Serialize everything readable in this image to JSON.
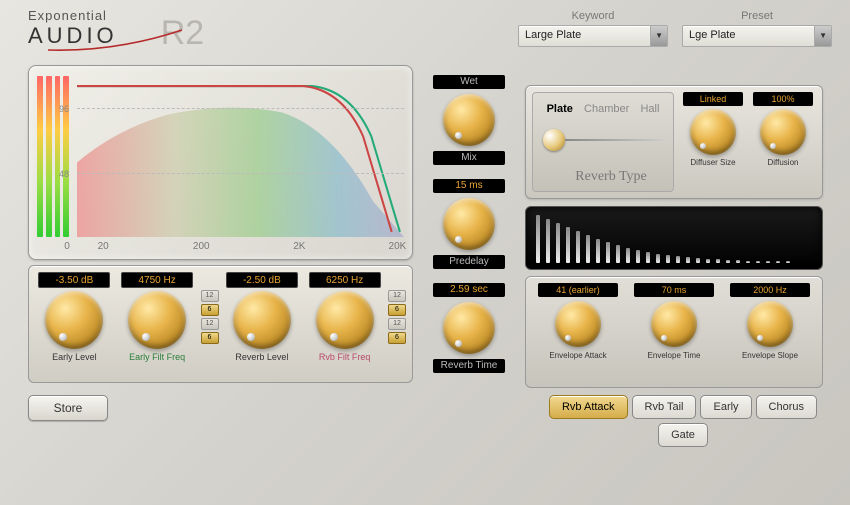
{
  "brand": {
    "line1": "Exponential",
    "line2": "AUDIO",
    "product": "R2"
  },
  "keyword": {
    "label": "Keyword",
    "value": "Large Plate"
  },
  "preset": {
    "label": "Preset",
    "value": "Lge Plate"
  },
  "graph": {
    "y_ticks": [
      "96",
      "48"
    ],
    "x_ticks": [
      "0",
      "20",
      "200",
      "2K",
      "20K"
    ]
  },
  "eq": {
    "early_level": {
      "value": "-3.50 dB",
      "label": "Early Level"
    },
    "early_filt": {
      "value": "4750 Hz",
      "label": "Early Filt Freq"
    },
    "reverb_level": {
      "value": "-2.50 dB",
      "label": "Reverb Level"
    },
    "rvb_filt": {
      "value": "6250 Hz",
      "label": "Rvb Filt Freq"
    },
    "slots": [
      "12",
      "6",
      "12",
      "6"
    ]
  },
  "store_label": "Store",
  "center": {
    "wet": {
      "top": "Wet",
      "bottom": "Mix"
    },
    "predelay": {
      "value": "15 ms",
      "label": "Predelay"
    },
    "time": {
      "value": "2.59 sec",
      "label": "Reverb Time"
    }
  },
  "reverb_type": {
    "options": [
      "Plate",
      "Chamber",
      "Hall"
    ],
    "selected": "Plate",
    "title": "Reverb Type",
    "diffuser_size": {
      "value": "Linked",
      "label": "Diffuser Size"
    },
    "diffusion": {
      "value": "100%",
      "label": "Diffusion"
    }
  },
  "envelope": {
    "attack": {
      "value": "41 (earlier)",
      "label": "Envelope Attack"
    },
    "time": {
      "value": "70 ms",
      "label": "Envelope Time"
    },
    "slope": {
      "value": "2000 Hz",
      "label": "Envelope Slope"
    }
  },
  "tabs": [
    "Rvb Attack",
    "Rvb Tail",
    "Early",
    "Chorus",
    "Gate"
  ],
  "active_tab": "Rvb Attack",
  "echo_bars": [
    48,
    44,
    40,
    36,
    32,
    28,
    24,
    21,
    18,
    15,
    13,
    11,
    9,
    8,
    7,
    6,
    5,
    4,
    4,
    3,
    3,
    2,
    2,
    2,
    2,
    2
  ]
}
